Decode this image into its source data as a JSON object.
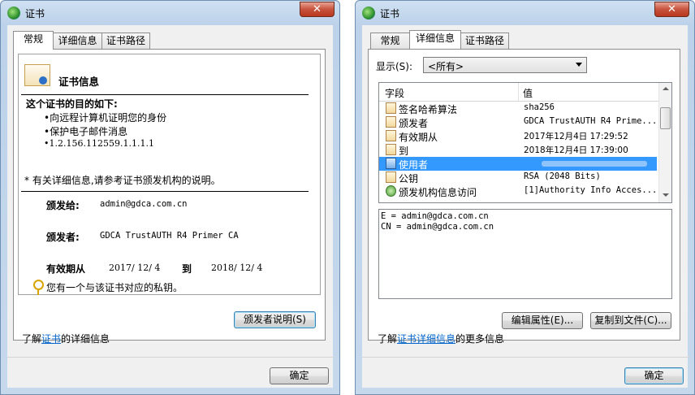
{
  "window_title": "证书",
  "close_symbol": "✕",
  "left": {
    "tabs": [
      "常规",
      "详细信息",
      "证书路径"
    ],
    "cert_info_title": "证书信息",
    "purpose_heading": "这个证书的目的如下:",
    "purposes": [
      "•向远程计算机证明您的身份",
      "•保护电子邮件消息",
      "•1.2.156.112559.1.1.1.1"
    ],
    "note": "* 有关详细信息,请参考证书颁发机构的说明。",
    "issued_to_label": "颁发给:",
    "issued_to_value": "admin@gdca.com.cn",
    "issued_by_label": "颁发者:",
    "issued_by_value": "GDCA TrustAUTH R4 Primer CA",
    "validity_label": "有效期从",
    "validity_from": "2017/ 12/ 4",
    "validity_to_word": "到",
    "validity_to": "2018/ 12/ 4",
    "private_key_text": "您有一个与该证书对应的私钥。",
    "issuer_statement_button": "颁发者说明(S)",
    "learn_prefix": "了解",
    "learn_link": "证书",
    "learn_suffix": "的详细信息",
    "ok_button": "确定"
  },
  "right": {
    "tabs": [
      "常规",
      "详细信息",
      "证书路径"
    ],
    "show_label": "显示(S):",
    "show_value": "<所有>",
    "column_field": "字段",
    "column_value": "值",
    "rows": [
      {
        "field": "签名哈希算法",
        "value": "sha256",
        "icon": "cert-field-icon"
      },
      {
        "field": "颁发者",
        "value": "GDCA TrustAUTH R4 Prime...",
        "icon": "cert-field-icon"
      },
      {
        "field": "有效期从",
        "value": "2017年12月4日 17:29:52",
        "icon": "cert-field-icon"
      },
      {
        "field": "到",
        "value": "2018年12月4日 17:39:00",
        "icon": "cert-field-icon"
      },
      {
        "field": "使用者",
        "value": "",
        "icon": "cert-field-icon",
        "selected": true
      },
      {
        "field": "公钥",
        "value": "RSA (2048 Bits)",
        "icon": "cert-field-icon"
      },
      {
        "field": "颁发机构信息访问",
        "value": "[1]Authority Info Acces...",
        "icon": "extension-icon"
      }
    ],
    "detail_text_line1": "E = admin@gdca.com.cn",
    "detail_text_line2": "CN = admin@gdca.com.cn",
    "edit_properties_button": "编辑属性(E)...",
    "copy_to_file_button": "复制到文件(C)...",
    "learn_prefix": "了解",
    "learn_link": "证书详细信息",
    "learn_suffix": "的更多信息",
    "ok_button": "确定"
  },
  "colors": {
    "accent_link": "#0066cc",
    "selection": "#3399ff",
    "close_button": "#c7523b"
  }
}
